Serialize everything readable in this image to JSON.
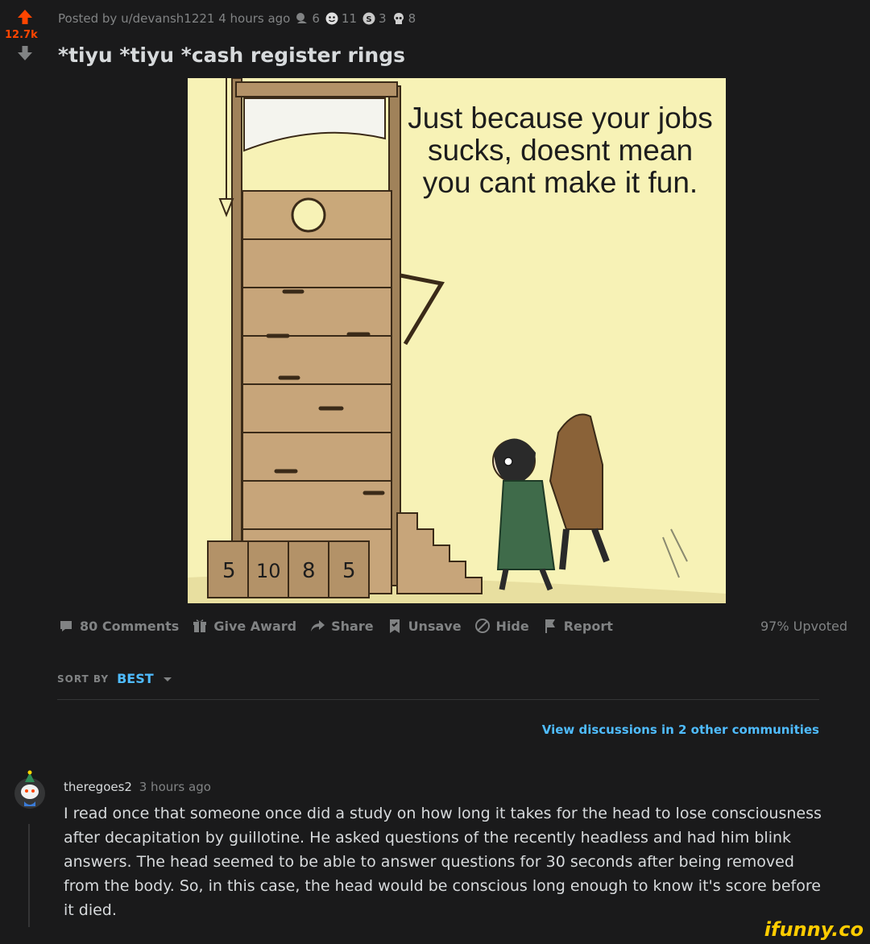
{
  "vote": {
    "score": "12.7k",
    "color": "#ff4500"
  },
  "meta": {
    "posted_by": "Posted by u/devansh1221 4 hours ago",
    "awards": [
      {
        "icon": "helpful-award-icon",
        "count": "6"
      },
      {
        "icon": "wholesome-award-icon",
        "count": "11"
      },
      {
        "icon": "silver-award-icon",
        "count": "3"
      },
      {
        "icon": "skull-award-icon",
        "count": "8"
      }
    ]
  },
  "post": {
    "title": "*tiyu *tiyu *cash register rings",
    "image": {
      "caption": "Just because your jobs sucks, doesnt mean you cant make it fun.",
      "score_boxes": [
        "5",
        "10",
        "8",
        "5"
      ]
    }
  },
  "actions": {
    "comments": "80 Comments",
    "give_award": "Give Award",
    "share": "Share",
    "unsave": "Unsave",
    "hide": "Hide",
    "report": "Report",
    "upvoted": "97% Upvoted"
  },
  "sort": {
    "label": "SORT BY",
    "value": "BEST"
  },
  "discussions_link": "View discussions in 2 other communities",
  "comment": {
    "author": "theregoes2",
    "time": "3 hours ago",
    "body": "I read once that someone once did a study on how long it takes for the head to lose consciousness after decapitation by guillotine. He asked questions of the recently headless and had him blink answers. The head seemed to be able to answer questions for 30 seconds after being removed from the body. So, in this case, the head would be conscious long enough to know it's score before it died."
  },
  "watermark": "ifunny.co",
  "colors": {
    "background": "#1a1a1b",
    "link": "#4fbcff",
    "muted": "#818384",
    "text": "#d7dadc"
  }
}
